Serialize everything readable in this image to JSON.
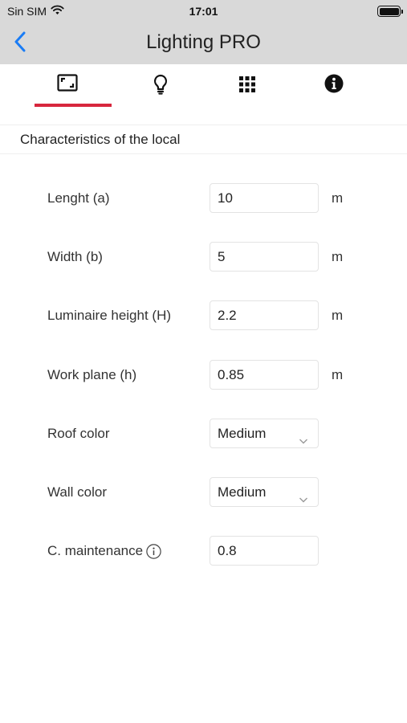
{
  "status_bar": {
    "carrier": "Sin SIM",
    "time": "17:01"
  },
  "nav": {
    "title": "Lighting PRO"
  },
  "tabs": [
    {
      "icon": "room-dimensions-icon",
      "active": true
    },
    {
      "icon": "lightbulb-icon",
      "active": false
    },
    {
      "icon": "grid-icon",
      "active": false
    },
    {
      "icon": "info-icon",
      "active": false
    }
  ],
  "accent_color": "#d7263d",
  "section": {
    "title": "Characteristics of the local"
  },
  "fields": {
    "length": {
      "label": "Lenght (a)",
      "value": "10",
      "unit": "m"
    },
    "width": {
      "label": "Width (b)",
      "value": "5",
      "unit": "m"
    },
    "luminaire_height": {
      "label": "Luminaire height (H)",
      "value": "2.2",
      "unit": "m"
    },
    "work_plane": {
      "label": "Work plane (h)",
      "value": "0.85",
      "unit": "m"
    },
    "roof_color": {
      "label": "Roof color",
      "value": "Medium"
    },
    "wall_color": {
      "label": "Wall color",
      "value": "Medium"
    },
    "maintenance": {
      "label": "C. maintenance",
      "value": "0.8"
    }
  }
}
